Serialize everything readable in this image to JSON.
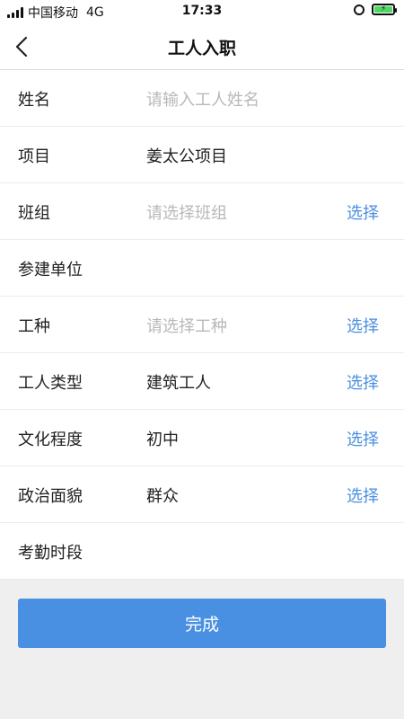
{
  "status_bar": {
    "carrier": "中国移动",
    "network": "4G",
    "time": "17:33",
    "battery_color": "#4cd964"
  },
  "nav": {
    "title": "工人入职",
    "back_icon": "chevron-left-icon"
  },
  "form": {
    "rows": [
      {
        "label": "姓名",
        "value": "",
        "placeholder": "请输入工人姓名",
        "action": ""
      },
      {
        "label": "项目",
        "value": "姜太公项目",
        "placeholder": "",
        "action": ""
      },
      {
        "label": "班组",
        "value": "",
        "placeholder": "请选择班组",
        "action": "选择"
      },
      {
        "label": "参建单位",
        "value": "",
        "placeholder": "",
        "action": ""
      },
      {
        "label": "工种",
        "value": "",
        "placeholder": "请选择工种",
        "action": "选择"
      },
      {
        "label": "工人类型",
        "value": "建筑工人",
        "placeholder": "",
        "action": "选择"
      },
      {
        "label": "文化程度",
        "value": "初中",
        "placeholder": "",
        "action": "选择"
      },
      {
        "label": "政治面貌",
        "value": "群众",
        "placeholder": "",
        "action": "选择"
      },
      {
        "label": "考勤时段",
        "value": "",
        "placeholder": "",
        "action": ""
      }
    ]
  },
  "done_button": {
    "label": "完成",
    "color": "#4a90e2"
  },
  "colors": {
    "accent": "#4a8fe0",
    "placeholder": "#b8b8b8",
    "background": "#efefef"
  }
}
